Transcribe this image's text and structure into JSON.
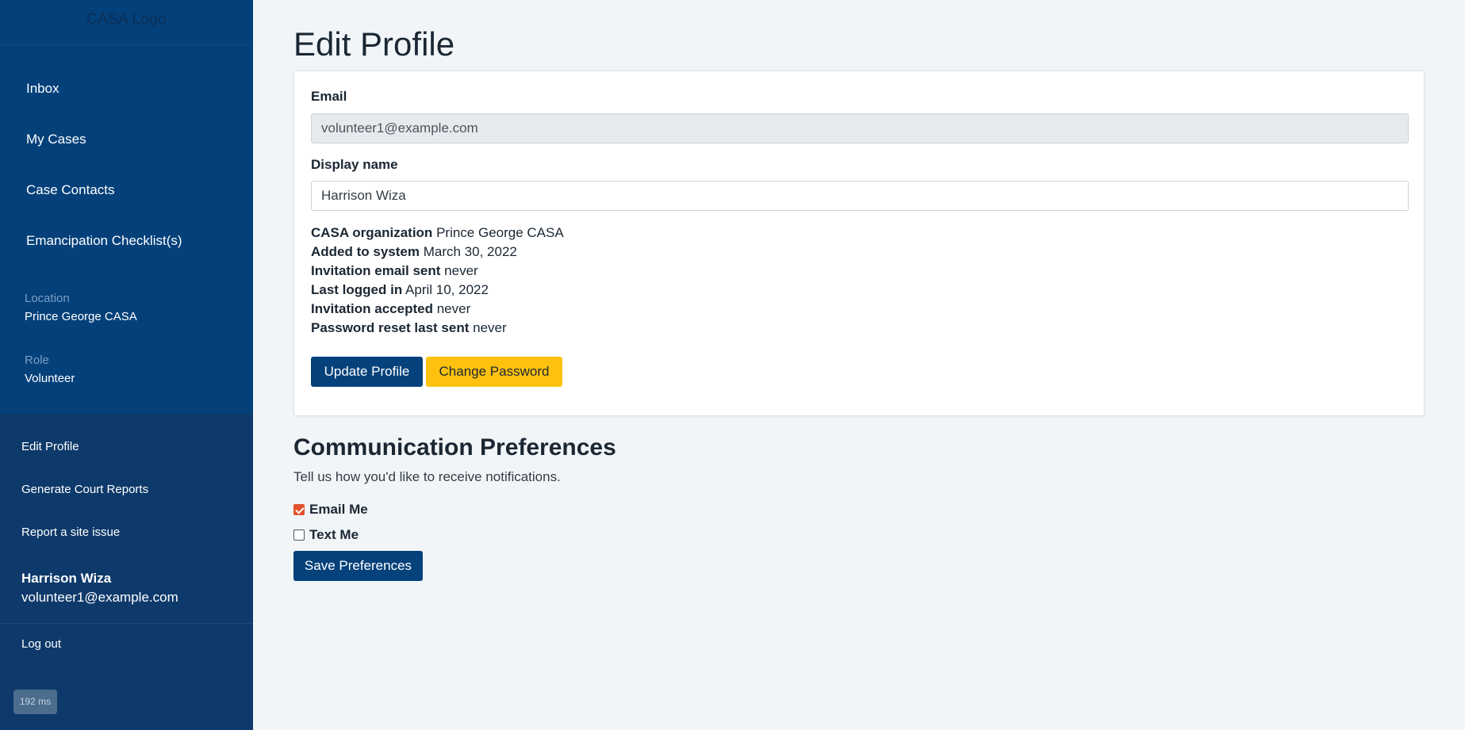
{
  "sidebar": {
    "logo": "CASA Logo",
    "nav": [
      {
        "label": "Inbox"
      },
      {
        "label": "My Cases"
      },
      {
        "label": "Case Contacts"
      },
      {
        "label": "Emancipation Checklist(s)"
      }
    ],
    "location_label": "Location",
    "location_value": "Prince George CASA",
    "role_label": "Role",
    "role_value": "Volunteer",
    "sub_nav": [
      {
        "label": "Edit Profile"
      },
      {
        "label": "Generate Court Reports"
      },
      {
        "label": "Report a site issue"
      }
    ],
    "user_name": "Harrison Wiza",
    "user_email": "volunteer1@example.com",
    "logout": "Log out",
    "perf_badge": "192 ms"
  },
  "main": {
    "title": "Edit Profile",
    "email_label": "Email",
    "email_value": "volunteer1@example.com",
    "display_name_label": "Display name",
    "display_name_value": "Harrison Wiza",
    "info": [
      {
        "label": "CASA organization",
        "value": "Prince George CASA"
      },
      {
        "label": "Added to system",
        "value": "March 30, 2022"
      },
      {
        "label": "Invitation email sent",
        "value": "never"
      },
      {
        "label": "Last logged in",
        "value": "April 10, 2022"
      },
      {
        "label": "Invitation accepted",
        "value": "never"
      },
      {
        "label": "Password reset last sent",
        "value": "never"
      }
    ],
    "update_button": "Update Profile",
    "change_password_button": "Change Password"
  },
  "preferences": {
    "title": "Communication Preferences",
    "subtitle": "Tell us how you'd like to receive notifications.",
    "options": [
      {
        "label": "Email Me",
        "checked": true
      },
      {
        "label": "Text Me",
        "checked": false
      }
    ],
    "save_button": "Save Preferences"
  },
  "colors": {
    "sidebar_top": "#04407a",
    "sidebar_bottom": "#0e3a6b",
    "primary": "#05417b",
    "warning": "#fec10e",
    "checkbox_accent": "#e2512b"
  }
}
